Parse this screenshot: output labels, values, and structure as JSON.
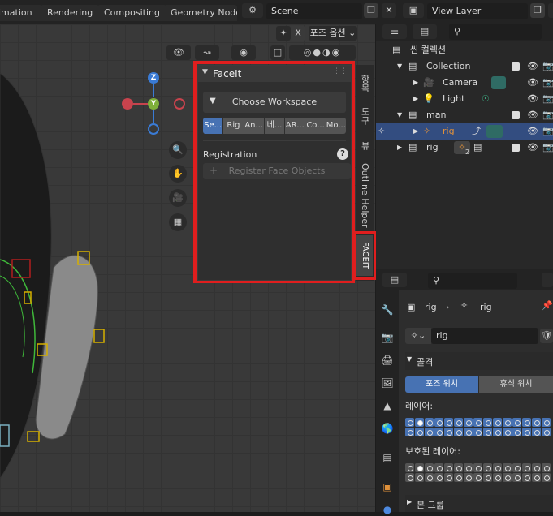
{
  "topbar": {
    "tabs": [
      "imation",
      "Rendering",
      "Compositing",
      "Geometry Node"
    ],
    "scene_label": "Scene",
    "view_layer_label": "View Layer"
  },
  "viewport": {
    "pose_options_label": "포즈 옵션",
    "x_label": "X",
    "gizmo": {
      "z": "Z",
      "y": "Y"
    }
  },
  "facelt_panel": {
    "title": "FaceIt",
    "workspace_button": "Choose Workspace",
    "workspace_tabs": [
      "Se...",
      "Rig",
      "An...",
      "베...",
      "AR...",
      "Co...",
      "Mo..."
    ],
    "registration_label": "Registration",
    "help_icon_label": "?",
    "register_button": "Register Face Objects"
  },
  "side_tabs": [
    "항목",
    "도구",
    "뷰",
    "Outline Helper",
    "FACEIT"
  ],
  "outliner": {
    "root_label": "씬 컬렉션",
    "rows": [
      {
        "label": "Collection",
        "indent": 1
      },
      {
        "label": "Camera",
        "indent": 2
      },
      {
        "label": "Light",
        "indent": 2
      },
      {
        "label": "man",
        "indent": 1
      },
      {
        "label": "rig",
        "indent": 2
      },
      {
        "label": "rig",
        "indent": 1
      }
    ],
    "rig_badge_count": "2"
  },
  "properties": {
    "breadcrumb_object": "rig",
    "breadcrumb_data": "rig",
    "name_field": "rig",
    "skeleton_label": "골격",
    "pose_position": "포즈 위치",
    "rest_position": "휴식 위치",
    "layers_label": "레이어:",
    "protected_layers_label": "보호된 레이어:",
    "bone_groups_label": "본 그룹"
  },
  "colors": {
    "accent": "#4772b3",
    "highlight_box": "#e01e1e",
    "gizmo_x": "#c8434d",
    "gizmo_y": "#7fb03a",
    "gizmo_z": "#3a7bd5"
  }
}
